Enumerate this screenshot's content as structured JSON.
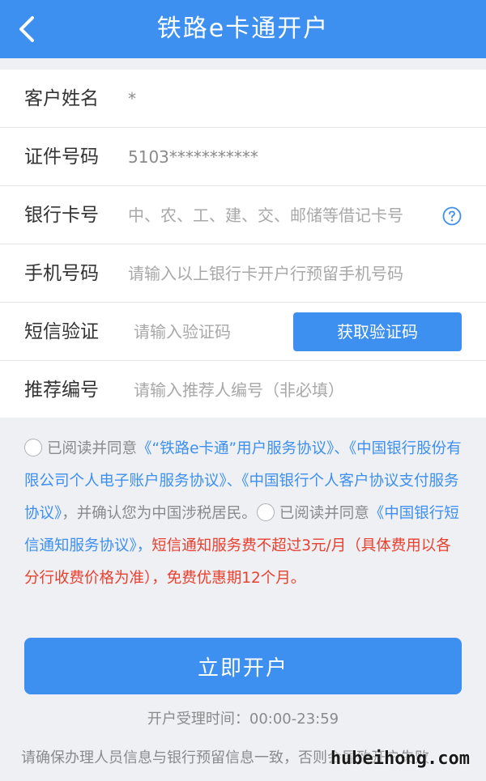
{
  "header": {
    "title": "铁路e卡通开户"
  },
  "form": {
    "rows": [
      {
        "label": "客户姓名",
        "value": "*"
      },
      {
        "label": "证件号码",
        "value": "5103***********"
      },
      {
        "label": "银行卡号",
        "placeholder": "中、农、工、建、交、邮储等借记卡号"
      },
      {
        "label": "手机号码",
        "placeholder": "请输入以上银行卡开户行预留手机号码"
      },
      {
        "label": "短信验证",
        "placeholder": "请输入验证码",
        "button": "获取验证码"
      },
      {
        "label": "推荐编号",
        "placeholder": "请输入推荐人编号（非必填）"
      }
    ]
  },
  "agreement": {
    "p1": "已阅读并同意",
    "link1": "《“铁路e卡通”用户服务协议》、《中国银行股份有限公司个人电子账户服务协议》、《中国银行个人客户协议支付服务协议》",
    "p2": "，并确认您为中国涉税居民。",
    "p3": "已阅读并同意",
    "link2": "《中国银行短信通知服务协议》，",
    "warning": "短信通知服务费不超过3元/月（具体费用以各分行收费价格为准），免费优惠期12个月。"
  },
  "submit_label": "立即开户",
  "hours": "开户受理时间：00:00-23:59",
  "notice": "请确保办理人员信息与银行预留信息一致，否则会导致开户失败",
  "watermark": "hubeihong.com",
  "colors": {
    "primary": "#3d8ff0",
    "warning": "#e8402f",
    "background": "#eef0f4"
  }
}
